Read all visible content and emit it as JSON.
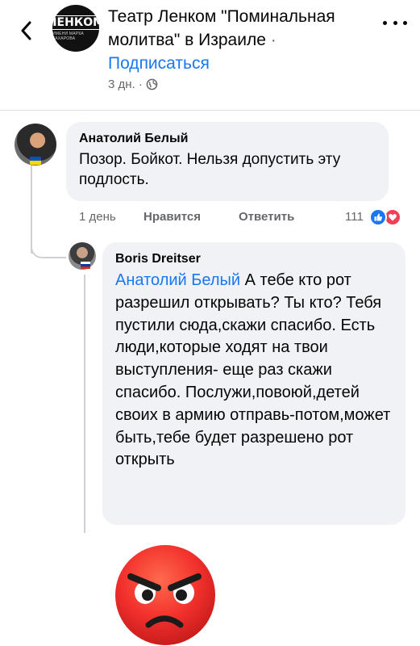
{
  "header": {
    "back_icon": "chevron-left-icon",
    "page_logo_text": "ЛЕНКОМ",
    "page_logo_subtext": "ИМЕНИ МАРКА ЗАХАРОВА",
    "title": "Театр Ленком \"Поминальная молитва\" в Израиле",
    "separator": " · ",
    "subscribe_label": "Подписаться",
    "time": "3 дн. ·",
    "privacy_icon": "globe-icon",
    "more_icon": "more-horizontal-icon"
  },
  "comments": [
    {
      "author": "Анатолий Белый",
      "text": "Позор. Бойкот. Нельзя допустить эту подлость.",
      "time": "1 день",
      "like_label": "Нравится",
      "reply_label": "Ответить",
      "reaction_count": "111",
      "reactions": [
        "like",
        "love"
      ],
      "badge_flag": "ukraine"
    },
    {
      "author": "Boris Dreitser",
      "mention": "Анатолий Белый",
      "text": " А тебе кто рот разрешил открывать? Ты кто? Тебя пустили сюда,скажи спасибо. Есть люди,которые ходят на твои выступления- еще раз скажи спасибо. Послужи,повоюй,детей своих в армию отправь-потом,может быть,тебе будет разрешено рот открыть",
      "badge_flag": "russia",
      "sticker": "angry-face-emoji"
    }
  ],
  "colors": {
    "accent": "#1877f2",
    "bubble": "#f0f2f5",
    "secondary_text": "#65676b",
    "love": "#f33e58"
  }
}
